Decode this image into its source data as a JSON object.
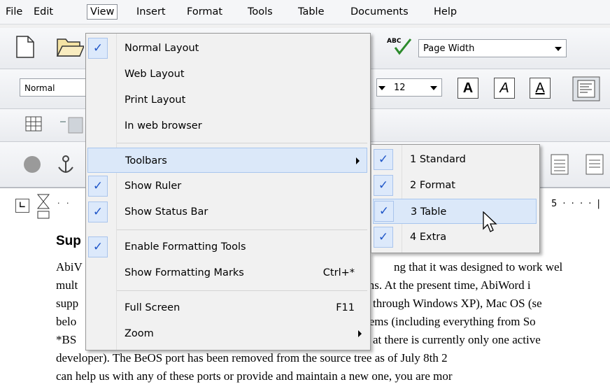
{
  "menubar": [
    "File",
    "Edit",
    "View",
    "Insert",
    "Format",
    "Tools",
    "Table",
    "Documents",
    "Help"
  ],
  "toolbar": {
    "zoom": "Page Width",
    "style": "Normal",
    "font_size": "12",
    "bold": "A",
    "italic": "A",
    "underline": "A"
  },
  "view_menu": {
    "items": [
      {
        "label": "Normal Layout",
        "checked": true
      },
      {
        "label": "Web Layout",
        "checked": false
      },
      {
        "label": "Print Layout",
        "checked": false
      },
      {
        "label": "In web browser",
        "checked": false
      },
      {
        "label": "Toolbars",
        "submenu": true
      },
      {
        "label": "Show Ruler",
        "checked": true
      },
      {
        "label": "Show Status Bar",
        "checked": true
      },
      {
        "label": "Enable Formatting Tools",
        "checked": true
      },
      {
        "label": "Show Formatting Marks",
        "shortcut": "Ctrl+*"
      },
      {
        "label": "Full Screen",
        "shortcut": "F11"
      },
      {
        "label": "Zoom",
        "submenu": true
      }
    ]
  },
  "toolbars_submenu": {
    "items": [
      {
        "label": "1 Standard",
        "checked": true
      },
      {
        "label": "2 Format",
        "checked": true
      },
      {
        "label": "3 Table",
        "checked": true,
        "hovered": true
      },
      {
        "label": "4 Extra",
        "checked": true
      }
    ]
  },
  "ruler": {
    "mark": "5"
  },
  "document": {
    "heading": "Sup",
    "lines": [
      {
        "left": "AbiV",
        "right": "ng that it was designed to work wel"
      },
      {
        "left": "mult",
        "right": "ms. At the present time, AbiWord i"
      },
      {
        "left": "supp",
        "right": "through Windows XP), Mac OS (se"
      },
      {
        "left": "belo",
        "right": "tems (including everything from So"
      },
      {
        "left": "*BS",
        "right": "at there is currently only one active"
      },
      {
        "left": "",
        "right": "developer).  The BeOS port has been removed from the source tree as of July 8th 2"
      },
      {
        "left": "",
        "right": "can help us with any of these ports or provide and maintain a new one, you are mor"
      }
    ]
  },
  "check_glyph": "✓"
}
